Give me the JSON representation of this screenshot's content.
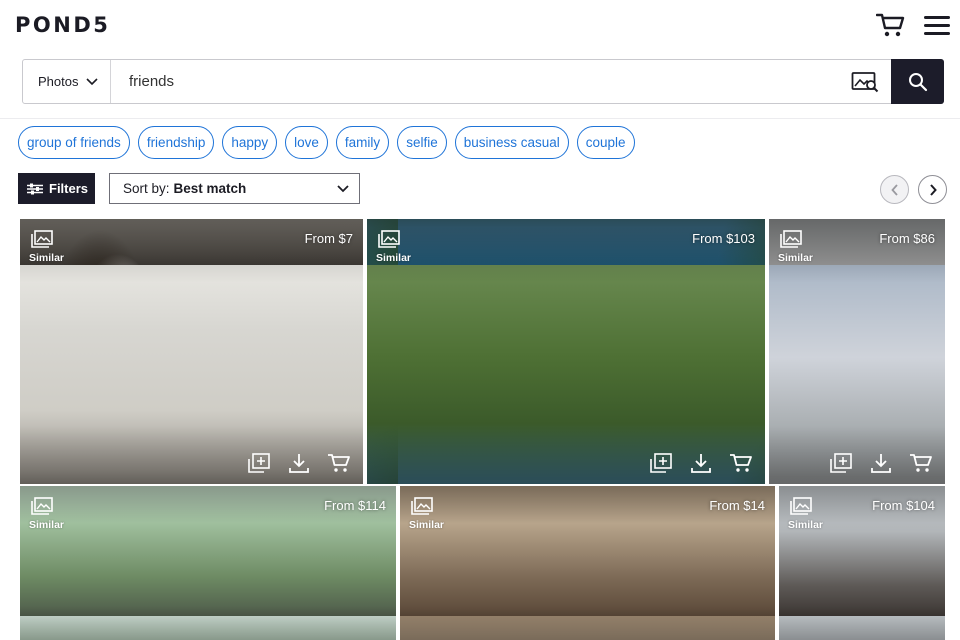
{
  "header": {
    "logo": "POND5",
    "cart_icon": "cart-icon",
    "menu_icon": "hamburger-menu-icon"
  },
  "search": {
    "type_label": "Photos",
    "query": "friends",
    "image_search_icon": "image-search-icon",
    "search_icon": "magnifier-icon"
  },
  "chips": [
    {
      "label": "group of friends"
    },
    {
      "label": "friendship"
    },
    {
      "label": "happy"
    },
    {
      "label": "love"
    },
    {
      "label": "family"
    },
    {
      "label": "selfie"
    },
    {
      "label": "business casual"
    },
    {
      "label": "couple"
    }
  ],
  "toolbar": {
    "filters_label": "Filters",
    "sort_prefix": "Sort by:",
    "sort_value": "Best match"
  },
  "results": [
    {
      "price": "From $7",
      "similar_label": "Similar"
    },
    {
      "price": "From $103",
      "similar_label": "Similar"
    },
    {
      "price": "From $86",
      "similar_label": "Similar"
    },
    {
      "price": "From $114",
      "similar_label": "Similar"
    },
    {
      "price": "From $14",
      "similar_label": "Similar"
    },
    {
      "price": "From $104",
      "similar_label": "Similar"
    }
  ],
  "colors": {
    "accent_blue": "#1f74d8",
    "dark_navy": "#1c1c2a"
  }
}
